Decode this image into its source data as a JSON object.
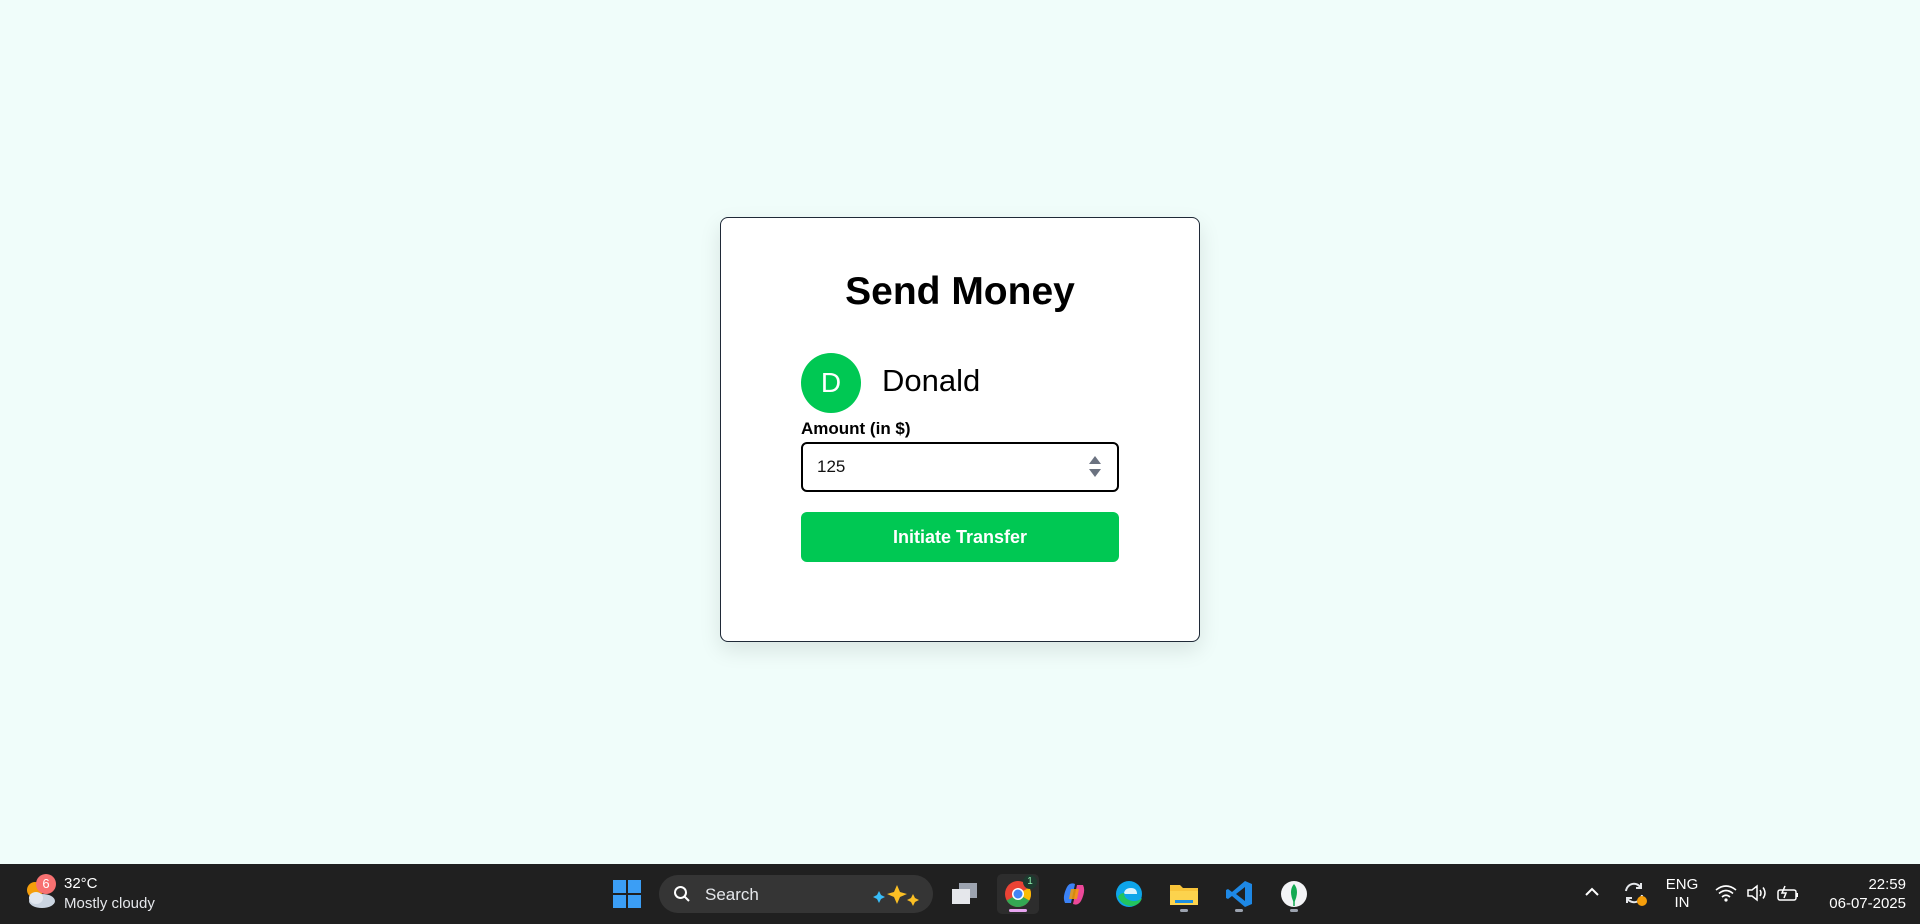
{
  "card": {
    "title": "Send Money",
    "recipient": {
      "initial": "D",
      "name": "Donald"
    },
    "amount_label": "Amount (in $)",
    "amount_value": "125",
    "button_label": "Initiate Transfer"
  },
  "colors": {
    "accent": "#00c853",
    "page_bg": "#f0fdfa",
    "taskbar_bg": "#202020"
  },
  "taskbar": {
    "weather": {
      "badge": "6",
      "temperature": "32°C",
      "condition": "Mostly cloudy",
      "icon": "partly-cloudy-icon"
    },
    "search_label": "Search",
    "chrome_badge": "1",
    "apps": [
      "start-icon",
      "task-view-icon",
      "chrome-icon",
      "copilot-icon",
      "edge-icon",
      "file-explorer-icon",
      "vscode-icon",
      "mongodb-compass-icon"
    ],
    "lang_line1": "ENG",
    "lang_line2": "IN",
    "time": "22:59",
    "date": "06-07-2025"
  }
}
